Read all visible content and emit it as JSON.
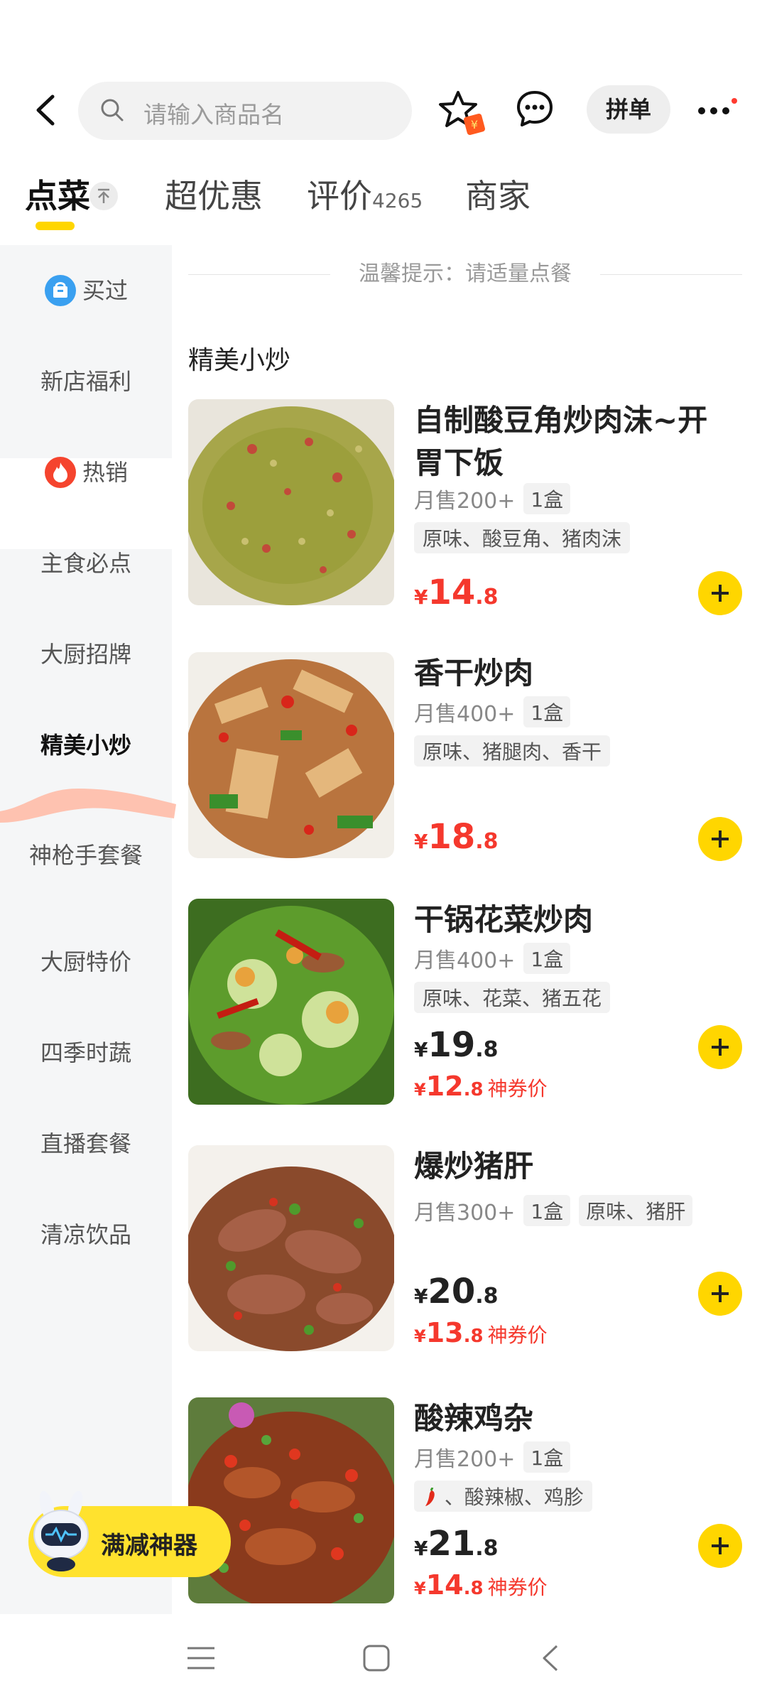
{
  "header": {
    "search_placeholder": "请输入商品名",
    "pindan_label": "拼单",
    "icons": [
      "back-arrow-icon",
      "search-icon",
      "favorite-star-icon",
      "chat-icon",
      "more-icon"
    ]
  },
  "tabs": [
    {
      "label": "点菜",
      "active": true
    },
    {
      "label": "超优惠"
    },
    {
      "label": "评价",
      "count": "4265"
    },
    {
      "label": "商家"
    }
  ],
  "sidebar": {
    "items": [
      {
        "label": "买过",
        "icon": "basket-icon"
      },
      {
        "label": "新店福利"
      },
      {
        "label": "热销",
        "icon": "flame-icon"
      },
      {
        "label": "主食必点"
      },
      {
        "label": "大厨招牌"
      },
      {
        "label": "精美小炒",
        "active": true
      },
      {
        "label": "神枪手套餐"
      },
      {
        "label": "大厨特价"
      },
      {
        "label": "四季时蔬"
      },
      {
        "label": "直播套餐"
      },
      {
        "label": "清凉饮品"
      }
    ]
  },
  "content": {
    "tip": "温馨提示：请适量点餐",
    "section_title": "精美小炒",
    "items": [
      {
        "name": "自制酸豆角炒肉沫~开胃下饭",
        "sales": "月售200+",
        "portion": "1盒",
        "tags": "原味、酸豆角、猪肉沫",
        "currency": "¥",
        "price_int": "14",
        "price_dec": ".8",
        "price_color": "#f5382d"
      },
      {
        "name": "香干炒肉",
        "sales": "月售400+",
        "portion": "1盒",
        "tags": "原味、猪腿肉、香干",
        "currency": "¥",
        "price_int": "18",
        "price_dec": ".8",
        "price_color": "#f5382d"
      },
      {
        "name": "干锅花菜炒肉",
        "sales": "月售400+",
        "portion": "1盒",
        "tags": "原味、花菜、猪五花",
        "currency": "¥",
        "price_int": "19",
        "price_dec": ".8",
        "coupon_int": "12",
        "coupon_dec": ".8",
        "coupon_label": "神券价"
      },
      {
        "name": "爆炒猪肝",
        "sales": "月售300+",
        "portion": "1盒",
        "tags": "原味、猪肝",
        "currency": "¥",
        "price_int": "20",
        "price_dec": ".8",
        "coupon_int": "13",
        "coupon_dec": ".8",
        "coupon_label": "神券价"
      },
      {
        "name": "酸辣鸡杂",
        "sales": "月售200+",
        "portion": "1盒",
        "tags": "、酸辣椒、鸡胗",
        "tag_icon": "chili-icon",
        "currency": "¥",
        "price_int": "21",
        "price_dec": ".8",
        "coupon_int": "14",
        "coupon_dec": ".8",
        "coupon_label": "神券价"
      }
    ]
  },
  "promo": {
    "label": "满减神器"
  },
  "colors": {
    "accent": "#ffd600",
    "price_red": "#f5382d",
    "sidebar_bg": "#f5f6f7"
  }
}
